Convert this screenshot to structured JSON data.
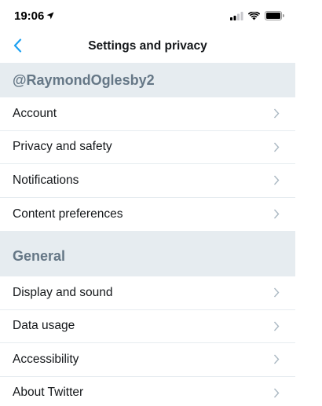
{
  "status_bar": {
    "time": "19:06"
  },
  "nav": {
    "title": "Settings and privacy"
  },
  "account_section": {
    "header": "@RaymondOglesby2",
    "items": [
      {
        "label": "Account"
      },
      {
        "label": "Privacy and safety"
      },
      {
        "label": "Notifications"
      },
      {
        "label": "Content preferences"
      }
    ]
  },
  "general_section": {
    "header": "General",
    "items": [
      {
        "label": "Display and sound"
      },
      {
        "label": "Data usage"
      },
      {
        "label": "Accessibility"
      },
      {
        "label": "About Twitter"
      }
    ]
  },
  "colors": {
    "accent": "#1da1f2",
    "section_bg": "#e6ecf0",
    "section_text": "#657786",
    "chevron": "#aab8c2",
    "text": "#14171a"
  },
  "icons": {
    "back": "chevron-left-icon",
    "row": "chevron-right-icon",
    "location": "location-arrow-icon",
    "signal": "cellular-signal-icon",
    "wifi": "wifi-icon",
    "battery": "battery-icon"
  }
}
